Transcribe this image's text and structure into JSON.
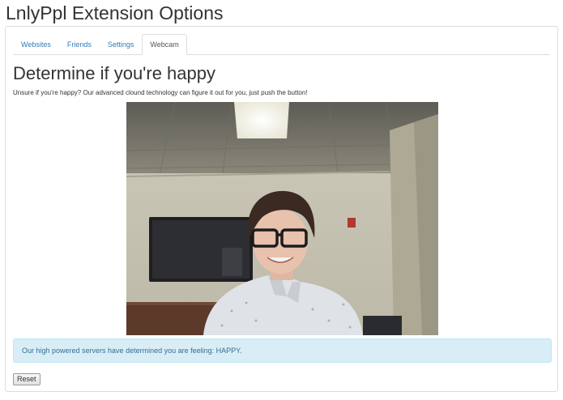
{
  "app": {
    "title": "LnlyPpl Extension Options"
  },
  "tabs": [
    {
      "label": "Websites",
      "active": false
    },
    {
      "label": "Friends",
      "active": false
    },
    {
      "label": "Settings",
      "active": false
    },
    {
      "label": "Webcam",
      "active": true
    }
  ],
  "main": {
    "heading": "Determine if you're happy",
    "description": "Unsure if you're happy? Our advanced clound technology can figure it out for you, just push the button!",
    "webcam_feed": {
      "icon": "webcam-snapshot"
    },
    "result_message": "Our high powered servers have determined you are feeling: HAPPY.",
    "reset_label": "Reset"
  },
  "colors": {
    "link": "#337ab7",
    "alert_bg": "#d9edf7",
    "alert_text": "#31708f",
    "border": "#dddddd"
  }
}
